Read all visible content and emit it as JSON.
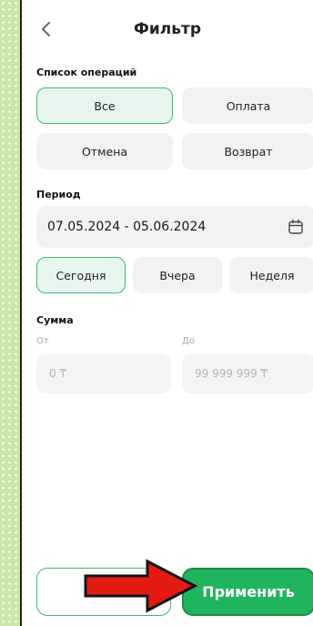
{
  "header": {
    "title": "Фильтр"
  },
  "operations": {
    "label": "Список операций",
    "options": [
      "Все",
      "Оплата",
      "Отмена",
      "Возврат"
    ],
    "selected": "Все"
  },
  "period": {
    "label": "Период",
    "date_range": "07.05.2024 - 05.06.2024",
    "quick": [
      "Сегодня",
      "Вчера",
      "Неделя"
    ],
    "selected": "Сегодня"
  },
  "amount": {
    "label": "Сумма",
    "from_label": "От",
    "from_placeholder": "0 ₸",
    "to_label": "До",
    "to_placeholder": "99 999 999 ₸"
  },
  "footer": {
    "reset_label": "Сбросить",
    "reset_visible_text": "Сб",
    "apply_label": "Применить"
  },
  "colors": {
    "accent": "#21b45e",
    "annotation_arrow": "#e41b13"
  },
  "icons": [
    "back-chevron-icon",
    "calendar-icon",
    "red-arrow-annotation"
  ]
}
